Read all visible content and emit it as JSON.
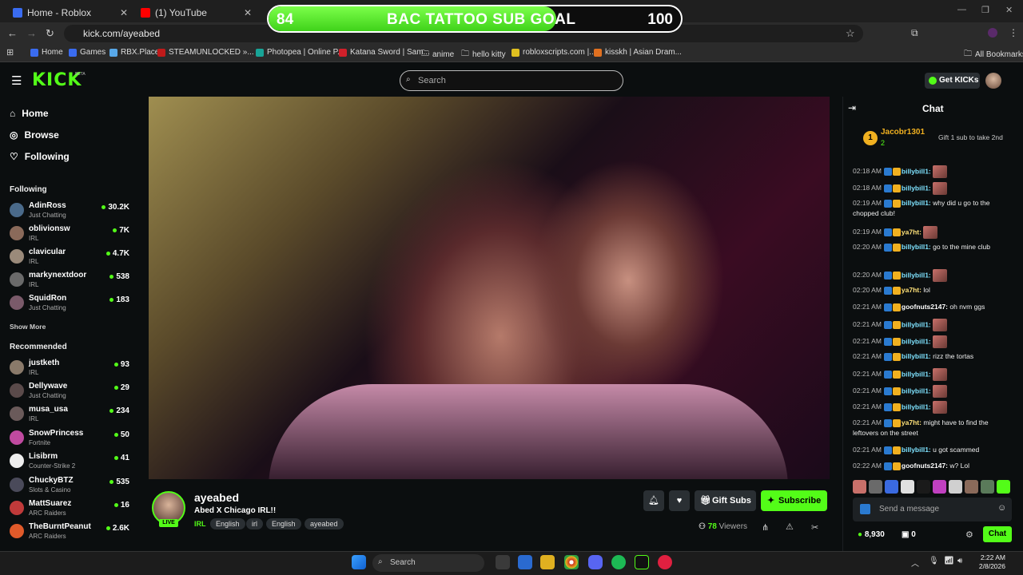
{
  "browser": {
    "tabs": [
      {
        "label": "Home - Roblox",
        "color": "#3a6cf0"
      },
      {
        "label": "(1) YouTube",
        "color": "#ff0000"
      }
    ],
    "url": "kick.com/ayeabed",
    "bookmarks": [
      "Home",
      "Games",
      "RBX.Place",
      "STEAMUNLOCKED »...",
      "Photopea | Online P...",
      "Katana Sword | Sam...",
      "anime",
      "hello kitty",
      "robloxscripts.com |...",
      "kisskh | Asian Dram...",
      "All Bookmarks"
    ]
  },
  "goal": {
    "current": "84",
    "title": "BAC TATTOO SUB GOAL",
    "max": "100",
    "progress_fraction": 0.84
  },
  "kick": {
    "logo": "KICK",
    "beta": "BETA",
    "search_placeholder": "Search",
    "get_kicks": "Get KICKs"
  },
  "sidebar": {
    "nav": [
      "Home",
      "Browse",
      "Following"
    ],
    "following_header": "Following",
    "following": [
      {
        "name": "AdinRoss",
        "category": "Just Chatting",
        "viewers": "30.2K"
      },
      {
        "name": "oblivionsw",
        "category": "IRL",
        "viewers": "7K"
      },
      {
        "name": "clavicular",
        "category": "IRL",
        "viewers": "4.7K"
      },
      {
        "name": "markynextdoor",
        "category": "IRL",
        "viewers": "538"
      },
      {
        "name": "SquidRon",
        "category": "Just Chatting",
        "viewers": "183"
      }
    ],
    "show_more": "Show More",
    "recommended_header": "Recommended",
    "recommended": [
      {
        "name": "justketh",
        "category": "IRL",
        "viewers": "93"
      },
      {
        "name": "Dellywave",
        "category": "Just Chatting",
        "viewers": "29"
      },
      {
        "name": "musa_usa",
        "category": "IRL",
        "viewers": "234"
      },
      {
        "name": "SnowPrincess",
        "category": "Fortnite",
        "viewers": "50"
      },
      {
        "name": "Lisibrm",
        "category": "Counter-Strike 2",
        "viewers": "41"
      },
      {
        "name": "ChuckyBTZ",
        "category": "Slots & Casino",
        "viewers": "535"
      },
      {
        "name": "MattSuarez",
        "category": "ARC Raiders",
        "viewers": "16"
      },
      {
        "name": "TheBurntPeanut",
        "category": "ARC Raiders",
        "viewers": "2.6K"
      }
    ]
  },
  "stream": {
    "streamer": "ayeabed",
    "title": "Abed X Chicago IRL!!",
    "live": "LIVE",
    "category": "IRL",
    "tags": [
      "English",
      "irl",
      "English",
      "ayeabed"
    ],
    "gift_subs": "Gift Subs",
    "subscribe": "Subscribe",
    "viewers": "78",
    "viewers_label": "Viewers"
  },
  "chat": {
    "title": "Chat",
    "pinned_user": "Jacobr1301",
    "pinned_count": "2",
    "pinned_rank": "1",
    "gift_prompt": "Gift 1 sub to take 2nd",
    "messages": [
      {
        "time": "02:18 AM",
        "user": "billybill1:",
        "text": "",
        "emote": true
      },
      {
        "time": "02:18 AM",
        "user": "billybill1:",
        "text": "",
        "emote": true
      },
      {
        "time": "02:19 AM",
        "user": "billybill1:",
        "text": "why did u go to the chopped club!",
        "emote": false
      },
      {
        "time": "02:19 AM",
        "user": "ya7ht:",
        "text": "",
        "emote": true
      },
      {
        "time": "02:20 AM",
        "user": "billybill1:",
        "text": "go to the mine club",
        "emote": false
      },
      {
        "time": "02:20 AM",
        "user": "billybill1:",
        "text": "",
        "emote": true
      },
      {
        "time": "02:20 AM",
        "user": "ya7ht:",
        "text": "lol",
        "emote": false
      },
      {
        "time": "02:21 AM",
        "user": "goofnuts2147:",
        "text": "oh nvm ggs",
        "emote": false
      },
      {
        "time": "02:21 AM",
        "user": "billybill1:",
        "text": "",
        "emote": true
      },
      {
        "time": "02:21 AM",
        "user": "billybill1:",
        "text": "",
        "emote": true
      },
      {
        "time": "02:21 AM",
        "user": "billybill1:",
        "text": "rizz the tortas",
        "emote": false
      },
      {
        "time": "02:21 AM",
        "user": "billybill1:",
        "text": "",
        "emote": true
      },
      {
        "time": "02:21 AM",
        "user": "billybill1:",
        "text": "",
        "emote": true
      },
      {
        "time": "02:21 AM",
        "user": "billybill1:",
        "text": "",
        "emote": true
      },
      {
        "time": "02:21 AM",
        "user": "ya7ht:",
        "text": "might have to find the leftovers on the street",
        "emote": false
      },
      {
        "time": "02:21 AM",
        "user": "billybill1:",
        "text": "u got scammed",
        "emote": false
      },
      {
        "time": "02:22 AM",
        "user": "goofnuts2147:",
        "text": "w? Lol",
        "emote": false
      }
    ],
    "send_placeholder": "Send a message",
    "kicks_balance": "8,930",
    "gifts_count": "0",
    "chat_button": "Chat"
  },
  "taskbar": {
    "search": "Search",
    "time": "2:22 AM",
    "date": "2/8/2026"
  }
}
